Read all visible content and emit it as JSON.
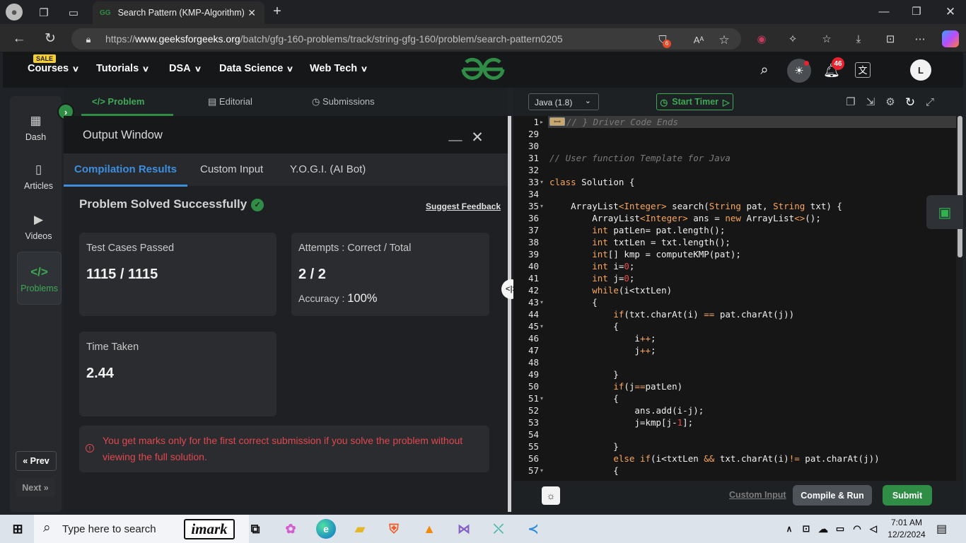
{
  "browser": {
    "tab_title": "Search Pattern (KMP-Algorithm) |",
    "tab_favicon": "GG",
    "url_prefix": "https://",
    "url_domain": "www.geeksforgeeks.org",
    "url_path": "/batch/gfg-160-problems/track/string-gfg-160/problem/search-pattern0205",
    "extension_badge": "6"
  },
  "site_nav": {
    "sale_badge": "SALE",
    "items": [
      "Courses",
      "Tutorials",
      "DSA",
      "Data Science",
      "Web Tech"
    ],
    "notification_count": "46",
    "avatar_letter": "L"
  },
  "sidebar": {
    "items": [
      {
        "label": "Dash",
        "icon": "dashboard-icon"
      },
      {
        "label": "Articles",
        "icon": "book-icon"
      },
      {
        "label": "Videos",
        "icon": "video-icon"
      },
      {
        "label": "Problems",
        "icon": "code-icon"
      }
    ],
    "prev": "Prev",
    "next": "Next"
  },
  "problem_tabs": {
    "problem": "Problem",
    "editorial": "Editorial",
    "submissions": "Submissions"
  },
  "output": {
    "title": "Output Window",
    "tabs": [
      "Compilation Results",
      "Custom Input",
      "Y.O.G.I. (AI Bot)"
    ],
    "status": "Problem Solved Successfully",
    "feedback": "Suggest Feedback",
    "tests_label": "Test Cases Passed",
    "tests_value": "1115 / 1115",
    "attempts_label": "Attempts : Correct / Total",
    "attempts_value": "2 / 2",
    "accuracy_label": "Accuracy :",
    "accuracy_value": "100%",
    "time_label": "Time Taken",
    "time_value": "2.44",
    "warning": "You get marks only for the first correct submission if you solve the problem without viewing the full solution."
  },
  "editor": {
    "language": "Java (1.8)",
    "timer": "Start Timer",
    "lines": [
      {
        "n": "1",
        "fold": true,
        "code": "// } Driver Code Ends"
      },
      {
        "n": "29",
        "fold": false,
        "code": ""
      },
      {
        "n": "30",
        "fold": false,
        "code": ""
      },
      {
        "n": "31",
        "fold": false,
        "code": "// User function Template for Java"
      },
      {
        "n": "32",
        "fold": false,
        "code": ""
      },
      {
        "n": "33",
        "fold": true,
        "code": "class Solution {"
      },
      {
        "n": "34",
        "fold": false,
        "code": ""
      },
      {
        "n": "35",
        "fold": true,
        "code": "    ArrayList<Integer> search(String pat, String txt) {"
      },
      {
        "n": "36",
        "fold": false,
        "code": "        ArrayList<Integer> ans = new ArrayList<>();"
      },
      {
        "n": "37",
        "fold": false,
        "code": "        int patLen= pat.length();"
      },
      {
        "n": "38",
        "fold": false,
        "code": "        int txtLen = txt.length();"
      },
      {
        "n": "39",
        "fold": false,
        "code": "        int[] kmp = computeKMP(pat);"
      },
      {
        "n": "40",
        "fold": false,
        "code": "        int i=0;"
      },
      {
        "n": "41",
        "fold": false,
        "code": "        int j=0;"
      },
      {
        "n": "42",
        "fold": false,
        "code": "        while(i<txtLen)"
      },
      {
        "n": "43",
        "fold": true,
        "code": "        {"
      },
      {
        "n": "44",
        "fold": false,
        "code": "            if(txt.charAt(i) == pat.charAt(j))"
      },
      {
        "n": "45",
        "fold": true,
        "code": "            {"
      },
      {
        "n": "46",
        "fold": false,
        "code": "                i++;"
      },
      {
        "n": "47",
        "fold": false,
        "code": "                j++;"
      },
      {
        "n": "48",
        "fold": false,
        "code": ""
      },
      {
        "n": "49",
        "fold": false,
        "code": "            }"
      },
      {
        "n": "50",
        "fold": false,
        "code": "            if(j==patLen)"
      },
      {
        "n": "51",
        "fold": true,
        "code": "            {"
      },
      {
        "n": "52",
        "fold": false,
        "code": "                ans.add(i-j);"
      },
      {
        "n": "53",
        "fold": false,
        "code": "                j=kmp[j-1];"
      },
      {
        "n": "54",
        "fold": false,
        "code": ""
      },
      {
        "n": "55",
        "fold": false,
        "code": "            }"
      },
      {
        "n": "56",
        "fold": false,
        "code": "            else if(i<txtLen && txt.charAt(i)!= pat.charAt(j))"
      },
      {
        "n": "57",
        "fold": true,
        "code": "            {"
      }
    ],
    "custom_input": "Custom Input",
    "compile": "Compile & Run",
    "submit": "Submit"
  },
  "taskbar": {
    "search_placeholder": "Type here to search",
    "imark": "imark",
    "time": "7:01 AM",
    "date": "12/2/2024"
  },
  "colors": {
    "gfg_green": "#2f8d46",
    "link_blue": "#3e8ede",
    "warning_red": "#e0484f",
    "code_keyword": "#f9a65a"
  }
}
